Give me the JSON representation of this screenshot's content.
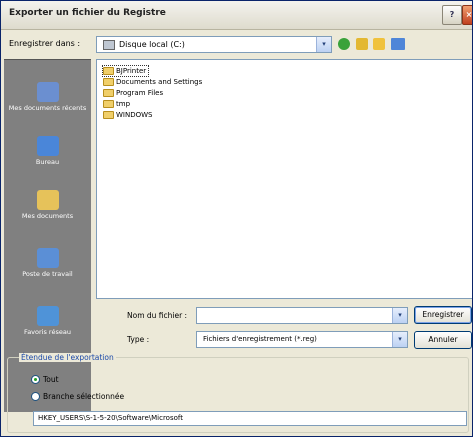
{
  "window": {
    "title": "Exporter un fichier du Registre",
    "help_label": "?",
    "close_label": "×"
  },
  "toolbar": {
    "save_in_label": "Enregistrer dans :",
    "save_in_value": "Disque local (C:)",
    "dropdown_glyph": "▾",
    "icons": [
      "back-icon",
      "up-folder-icon",
      "new-folder-icon",
      "view-menu-icon"
    ]
  },
  "places": [
    {
      "label": "Mes documents récents",
      "icon": "recent-documents-icon",
      "color": "#6b8fd0"
    },
    {
      "label": "Bureau",
      "icon": "desktop-icon",
      "color": "#4a86d9"
    },
    {
      "label": "Mes documents",
      "icon": "my-documents-icon",
      "color": "#e6c25a"
    },
    {
      "label": "Poste de travail",
      "icon": "my-computer-icon",
      "color": "#5b8fd6"
    },
    {
      "label": "Favoris réseau",
      "icon": "network-places-icon",
      "color": "#4f93d8"
    }
  ],
  "files": [
    {
      "name": "BJPrinter",
      "selected": true
    },
    {
      "name": "Documents and Settings",
      "selected": false
    },
    {
      "name": "Program Files",
      "selected": false
    },
    {
      "name": "tmp",
      "selected": false
    },
    {
      "name": "WINDOWS",
      "selected": false
    }
  ],
  "form": {
    "filename_label": "Nom du fichier :",
    "filename_value": "",
    "type_label": "Type :",
    "type_value": "Fichiers d'enregistrement (*.reg)",
    "save_button": "Enregistrer",
    "cancel_button": "Annuler"
  },
  "export_range": {
    "title": "Étendue de l'exportation",
    "all_label": "Tout",
    "all_selected": true,
    "branch_label": "Branche sélectionnée",
    "branch_selected": false,
    "branch_value": "HKEY_USERS\\S-1-5-20\\Software\\Microsoft"
  }
}
